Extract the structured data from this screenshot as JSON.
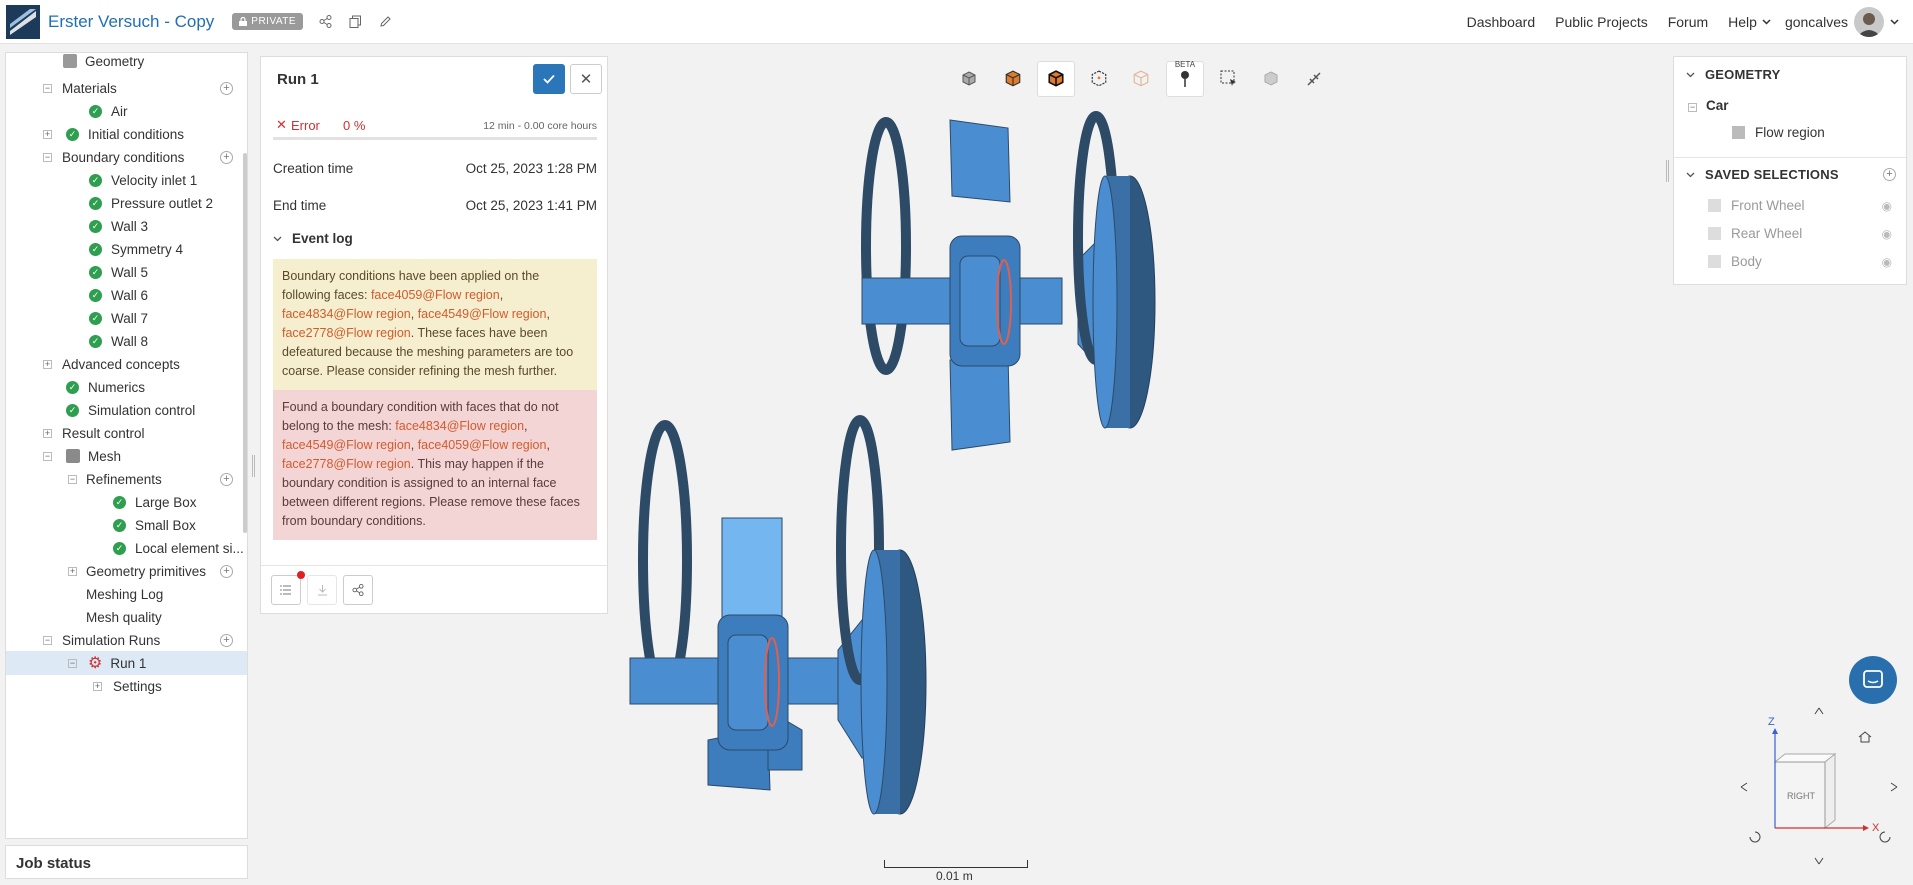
{
  "header": {
    "title": "Erster Versuch - Copy",
    "privacy_badge": "PRIVATE",
    "nav": [
      "Dashboard",
      "Public Projects",
      "Forum",
      "Help"
    ],
    "username": "goncalves"
  },
  "tree": {
    "items": [
      {
        "label": "Geometry"
      },
      {
        "label": "Materials"
      },
      {
        "label": "Air"
      },
      {
        "label": "Initial conditions"
      },
      {
        "label": "Boundary conditions"
      },
      {
        "label": "Velocity inlet 1"
      },
      {
        "label": "Pressure outlet 2"
      },
      {
        "label": "Wall 3"
      },
      {
        "label": "Symmetry 4"
      },
      {
        "label": "Wall 5"
      },
      {
        "label": "Wall 6"
      },
      {
        "label": "Wall 7"
      },
      {
        "label": "Wall 8"
      },
      {
        "label": "Advanced concepts"
      },
      {
        "label": "Numerics"
      },
      {
        "label": "Simulation control"
      },
      {
        "label": "Result control"
      },
      {
        "label": "Mesh"
      },
      {
        "label": "Refinements"
      },
      {
        "label": "Large Box"
      },
      {
        "label": "Small Box"
      },
      {
        "label": "Local element si..."
      },
      {
        "label": "Geometry primitives"
      },
      {
        "label": "Meshing Log"
      },
      {
        "label": "Mesh quality"
      },
      {
        "label": "Simulation Runs"
      },
      {
        "label": "Run 1"
      },
      {
        "label": "Settings"
      }
    ]
  },
  "job_status": "Job status",
  "run": {
    "title": "Run 1",
    "status": "Error",
    "progress": "0 %",
    "duration": "12 min - 0.00 core hours",
    "creation_label": "Creation time",
    "creation_value": "Oct 25, 2023 1:28 PM",
    "end_label": "End time",
    "end_value": "Oct 25, 2023 1:41 PM",
    "event_log_label": "Event log",
    "warn": {
      "t1": "Boundary conditions have been applied on the following faces: ",
      "f1": "face4059@Flow region",
      "f2": "face4834@Flow region",
      "f3": "face4549@Flow region",
      "f4": "face2778@Flow region",
      "t2": ". These faces have been defeatured because the meshing parameters are too coarse. Please consider refining the mesh further."
    },
    "error": {
      "t1": "Found a boundary condition with faces that do not belong to the mesh: ",
      "f1": "face4834@Flow region",
      "f2": "face4549@Flow region",
      "f3": "face4059@Flow region",
      "f4": "face2778@Flow region",
      "t2": ". This may happen if the boundary condition is assigned to an internal face between different regions. Please remove these faces from boundary conditions."
    }
  },
  "geometry_panel": {
    "geometry_head": "GEOMETRY",
    "car": "Car",
    "flow_region": "Flow region",
    "saved_head": "SAVED SELECTIONS",
    "selections": [
      "Front Wheel",
      "Rear Wheel",
      "Body"
    ]
  },
  "toolbar": {
    "beta": "BETA"
  },
  "scale_label": "0.01 m",
  "navcube": {
    "face": "RIGHT",
    "axis_z": "Z",
    "axis_x": "X"
  }
}
